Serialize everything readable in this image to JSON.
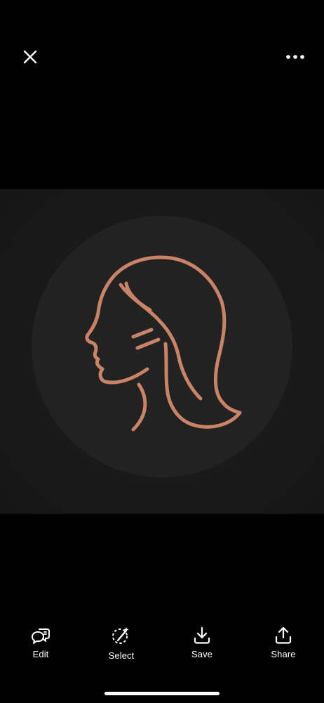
{
  "top_bar": {
    "close_icon": "close-icon",
    "more_icon": "more-horizontal-icon"
  },
  "image": {
    "subject": "woman-profile-logo",
    "background_color": "#1b1b1b",
    "circle_color": "#222222",
    "line_color": "#c98366"
  },
  "toolbar": {
    "items": [
      {
        "label": "Edit",
        "icon": "edit-chat-icon"
      },
      {
        "label": "Select",
        "icon": "select-magic-icon"
      },
      {
        "label": "Save",
        "icon": "download-icon"
      },
      {
        "label": "Share",
        "icon": "share-icon"
      }
    ]
  }
}
